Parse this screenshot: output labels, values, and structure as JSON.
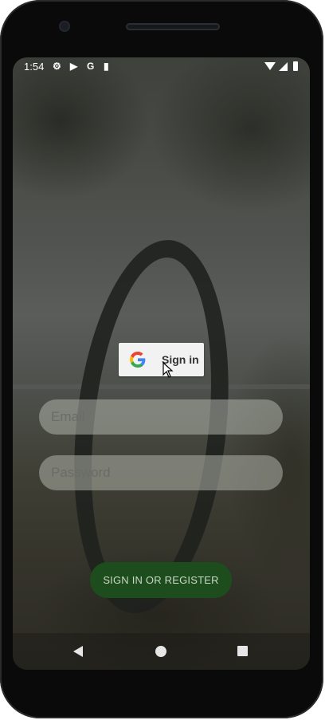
{
  "status_bar": {
    "time": "1:54",
    "icons": [
      "gear-icon",
      "play-protect-icon",
      "google-g-icon",
      "sd-card-icon",
      "wifi-icon",
      "signal-icon",
      "battery-icon"
    ]
  },
  "google_signin": {
    "label": "Sign in",
    "icon": "google-g-icon"
  },
  "form": {
    "email_placeholder": "Email",
    "password_placeholder": "Password",
    "submit_label": "SIGN IN OR REGISTER"
  },
  "navigation": {
    "icons": [
      "back-icon",
      "home-icon",
      "recents-icon"
    ]
  },
  "colors": {
    "primary_button": "#1d4d1c",
    "field_background": "#afb2aa",
    "google_button": "#f2f2f2"
  }
}
